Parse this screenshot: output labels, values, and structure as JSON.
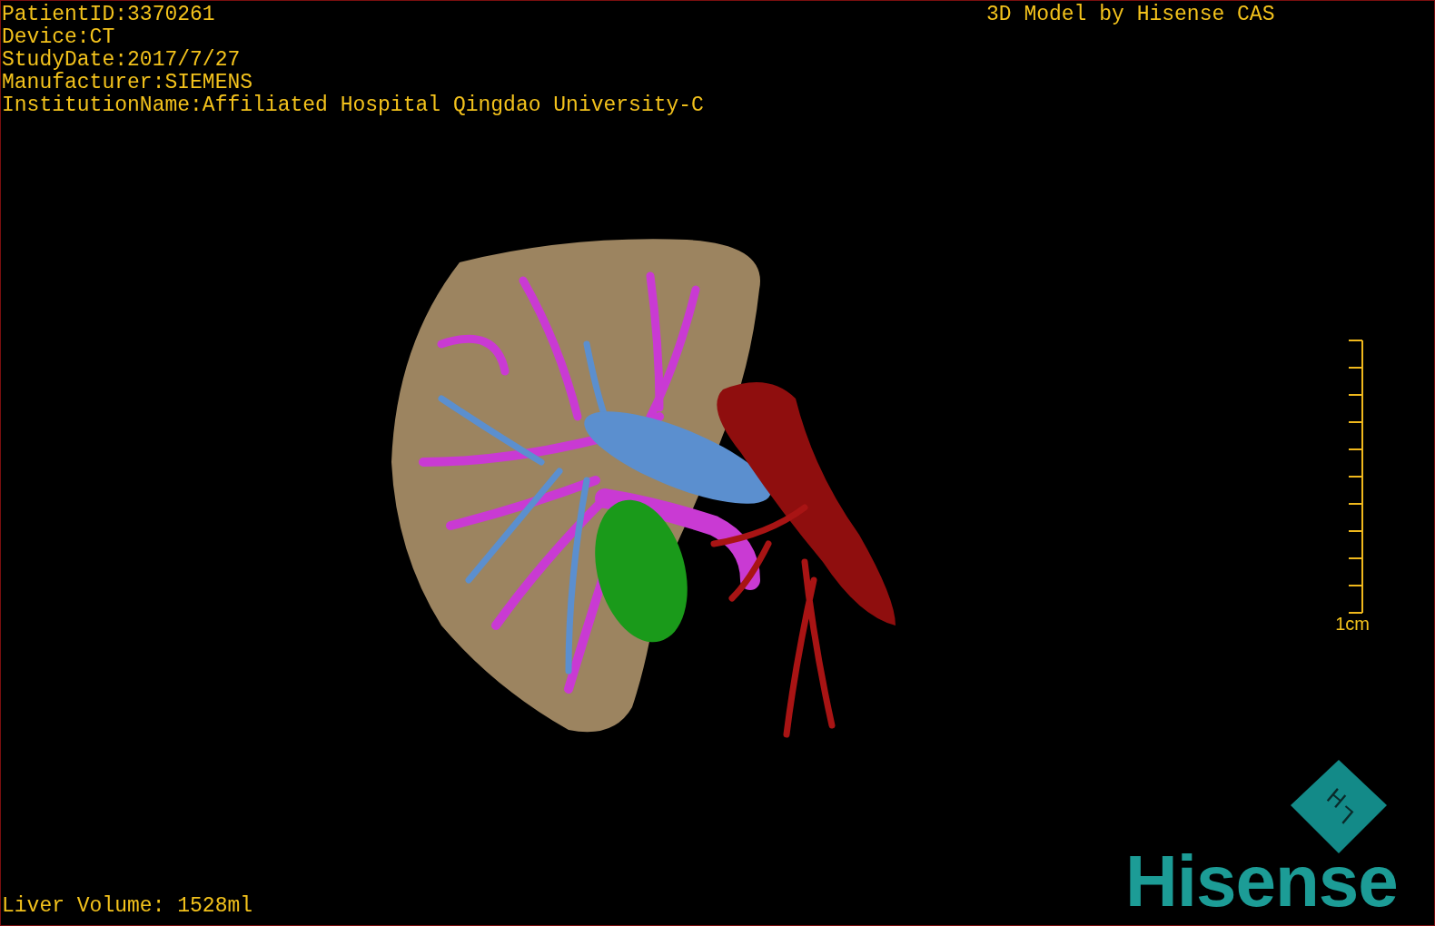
{
  "study_info": [
    "PatientID:3370261",
    "Device:CT",
    "StudyDate:2017/7/27",
    "Manufacturer:SIEMENS",
    "InstitutionName:Affiliated Hospital Qingdao University-C"
  ],
  "model_credit": "3D Model by Hisense CAS",
  "scale_bar": {
    "label": "1cm"
  },
  "liver_volume": "Liver Volume: 1528ml",
  "orientation_cube": {
    "labels": [
      "H",
      "L"
    ]
  },
  "logo": "Hisense"
}
